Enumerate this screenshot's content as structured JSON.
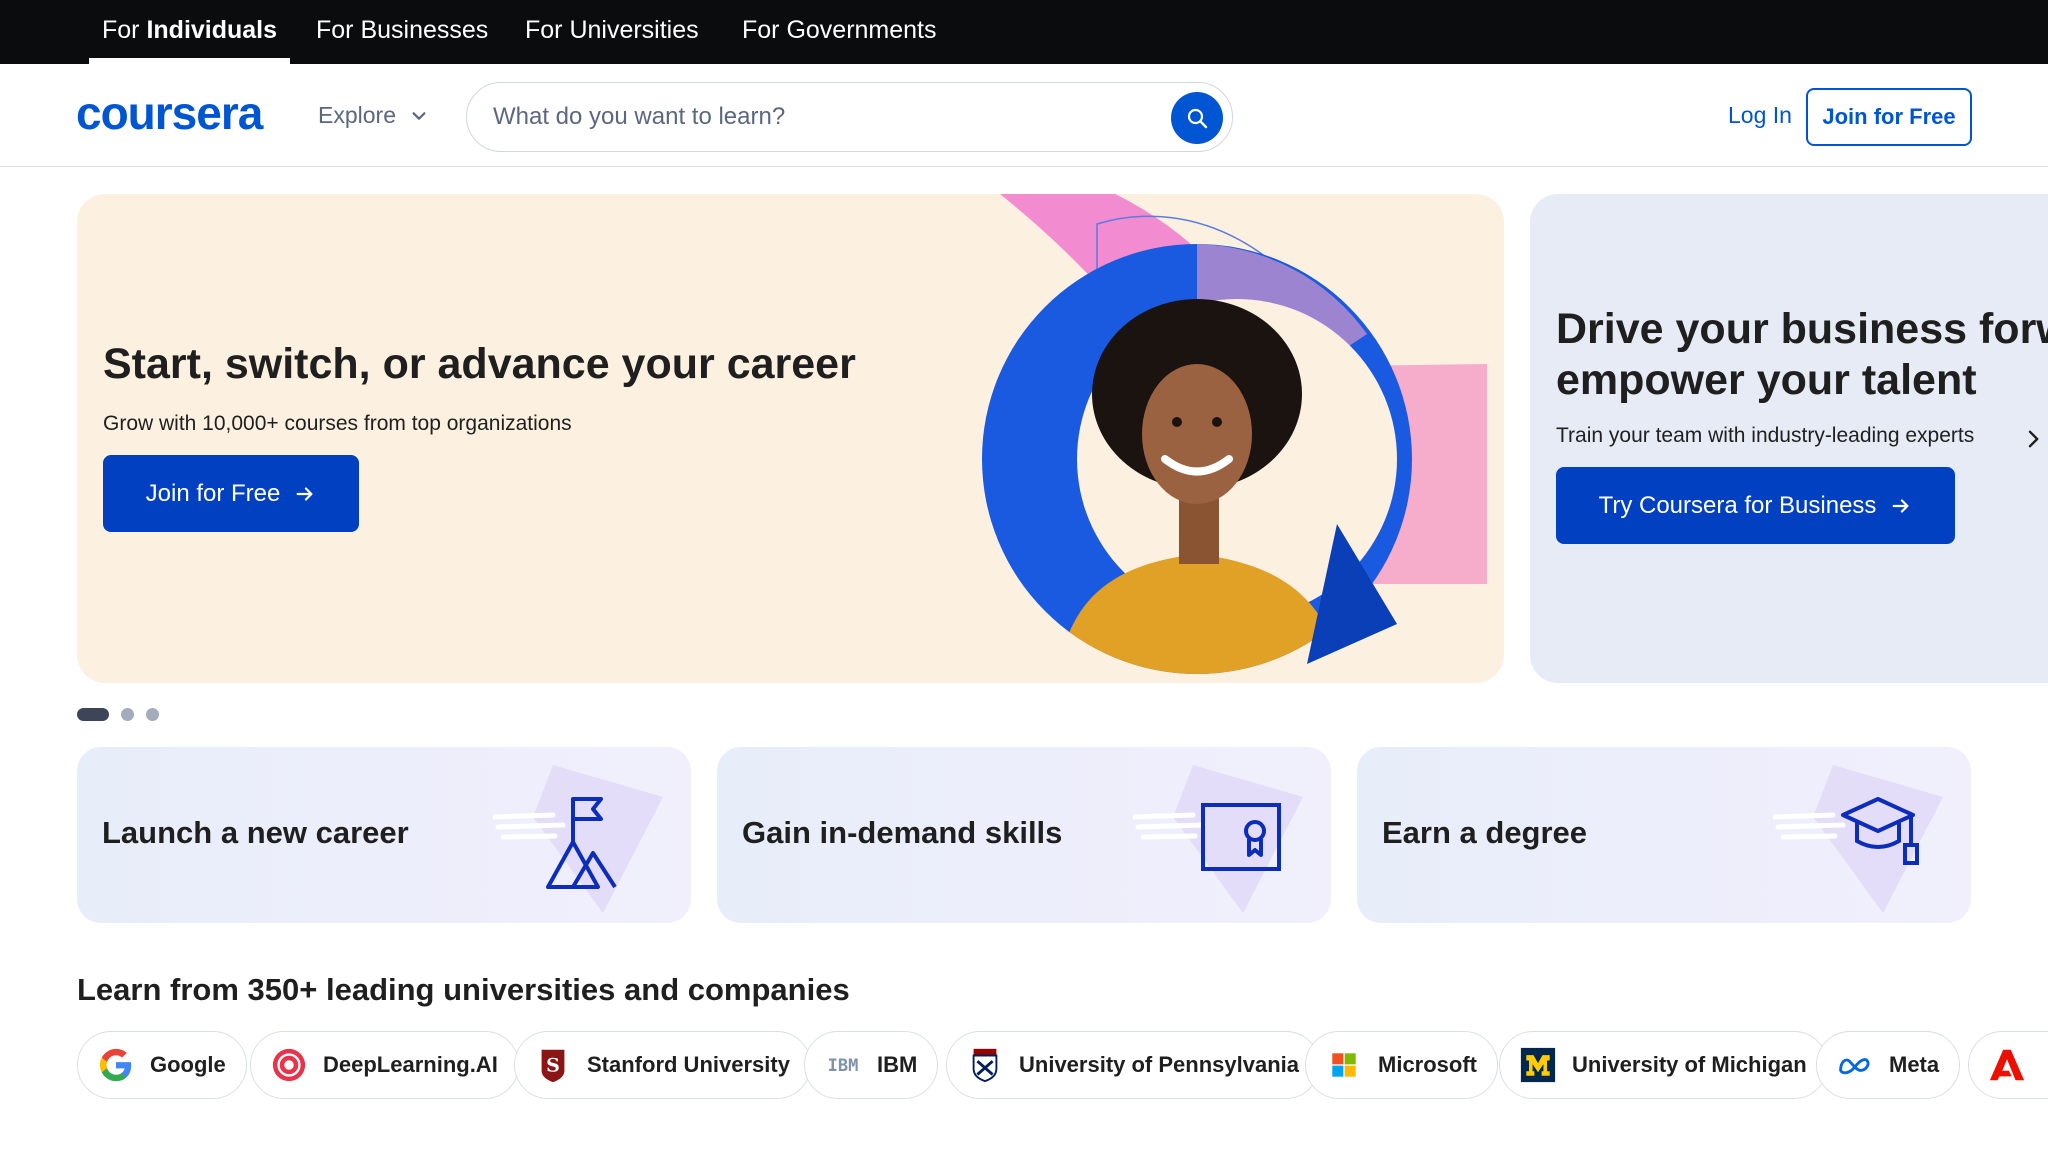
{
  "audience_tabs": [
    {
      "prefix": "For ",
      "strong": "Individuals"
    },
    {
      "label": "For Businesses"
    },
    {
      "label": "For Universities"
    },
    {
      "label": "For Governments"
    }
  ],
  "header": {
    "logo": "coursera",
    "explore": "Explore",
    "search_placeholder": "What do you want to learn?",
    "login": "Log In",
    "join": "Join for Free"
  },
  "hero": {
    "title": "Start, switch, or advance your career",
    "subtitle": "Grow with 10,000+ courses from top organizations",
    "cta": "Join for Free"
  },
  "hero_secondary": {
    "title_line1": "Drive your business forwa",
    "title_line2": "empower your talent",
    "subtitle": "Train your team with industry-leading experts",
    "cta": "Try Coursera for Business"
  },
  "carousel": {
    "count": 3,
    "active": 0
  },
  "goals": [
    {
      "label": "Launch a new career",
      "icon": "mountain-flag-icon"
    },
    {
      "label": "Gain in-demand skills",
      "icon": "certificate-icon"
    },
    {
      "label": "Earn a degree",
      "icon": "graduation-cap-icon"
    }
  ],
  "partners_title": "Learn from 350+ leading universities and companies",
  "partners": [
    {
      "name": "Google",
      "logo": "google-logo"
    },
    {
      "name": "DeepLearning.AI",
      "logo": "deeplearning-ai-logo"
    },
    {
      "name": "Stanford University",
      "logo": "stanford-logo"
    },
    {
      "name": "IBM",
      "logo": "ibm-logo"
    },
    {
      "name": "University of Pennsylvania",
      "logo": "upenn-logo"
    },
    {
      "name": "Microsoft",
      "logo": "microsoft-logo"
    },
    {
      "name": "University of Michigan",
      "logo": "umich-logo"
    },
    {
      "name": "Meta",
      "logo": "meta-logo"
    }
  ],
  "colors": {
    "brand_blue": "#0056d2",
    "button_blue": "#0040c1",
    "hero_bg": "#fcf1e0",
    "hero_secondary_bg": "#e6ebf6",
    "top_bar": "#0b0c0e"
  }
}
